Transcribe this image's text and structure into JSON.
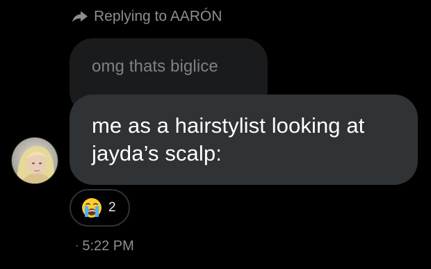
{
  "reply_header": {
    "text": "Replying to AARÓN",
    "icon": "reply-arrow-icon"
  },
  "quoted_message": {
    "text": "omg thats biglice"
  },
  "message": {
    "lines": [
      "me as a hairstylist looking at",
      "jayda’s scalp:"
    ]
  },
  "reaction": {
    "emoji": "😭",
    "emoji_icon": "loudly-crying-face-icon",
    "count": "2"
  },
  "timestamp": {
    "separator": "·",
    "time": "5:22 PM"
  },
  "colors": {
    "background": "#000000",
    "bubble": "#2f3336",
    "quoted_bubble": "#1a1b1d",
    "muted_text": "#8b8f94"
  }
}
